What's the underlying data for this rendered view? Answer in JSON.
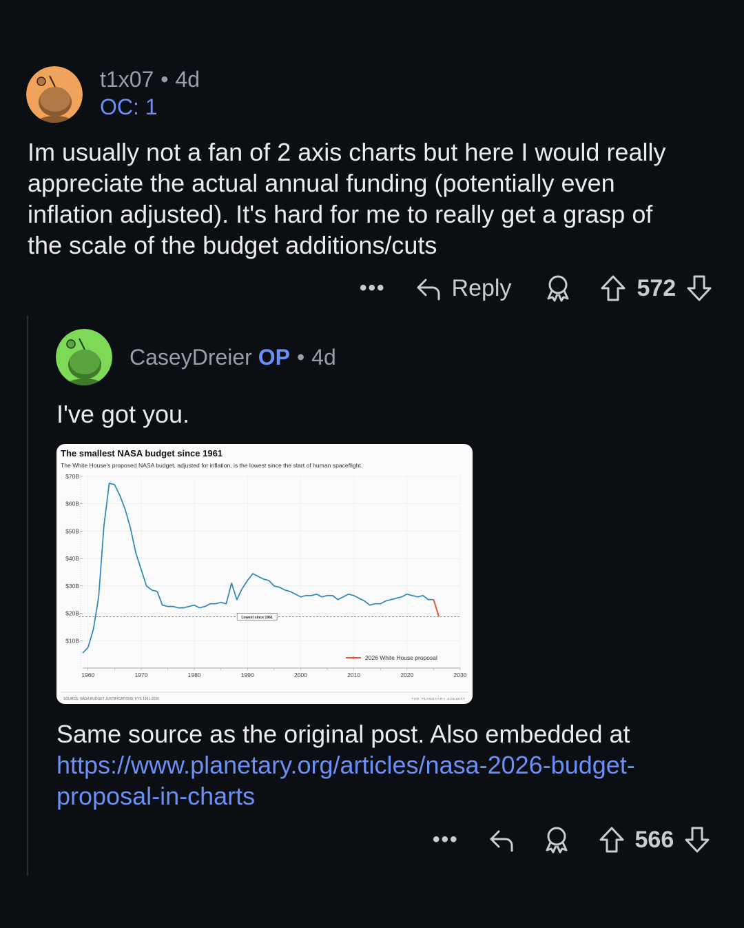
{
  "comments": [
    {
      "username": "t1x07",
      "separator": "•",
      "age": "4d",
      "flair": "OC: 1",
      "avatar_color": "#f0a35a",
      "body": [
        "Im usually not a fan of 2 axis charts but here I would really",
        "appreciate the actual annual funding (potentially even",
        "inflation adjusted). It's hard for me to really get a grasp of",
        "the scale of the budget additions/cuts"
      ],
      "actions": {
        "more": "•••",
        "reply_label": "Reply",
        "score": "572"
      }
    },
    {
      "username": "CaseyDreier",
      "op_badge": "OP",
      "separator": "•",
      "age": "4d",
      "avatar_color": "#7ed957",
      "body_intro": "I've got you.",
      "body_after": "Same source as the original post. Also embedded at",
      "link_lines": [
        "https://www.planetary.org/articles/nasa-2026-budget-",
        "proposal-in-charts"
      ],
      "actions": {
        "more": "•••",
        "score": "566"
      }
    }
  ],
  "chart_data": {
    "type": "line",
    "title": "The smallest NASA budget since 1961",
    "subtitle": "The White House's proposed NASA budget, adjusted for inflation, is the lowest since the start of human spaceflight.",
    "y_ticks": [
      "$70B",
      "$60B",
      "$50B",
      "$40B",
      "$30B",
      "$20B",
      "$10B"
    ],
    "y_tick_values": [
      70,
      60,
      50,
      40,
      30,
      20,
      10
    ],
    "x_ticks": [
      "1960",
      "1970",
      "1980",
      "1990",
      "2000",
      "2010",
      "2020",
      "2030"
    ],
    "x_tick_values": [
      1960,
      1970,
      1980,
      1990,
      2000,
      2010,
      2020,
      2030
    ],
    "xlim": [
      1959,
      2030
    ],
    "ylim": [
      0,
      70
    ],
    "series": [
      {
        "color": "#2a86b8",
        "x": [
          1959,
          1960,
          1961,
          1962,
          1963,
          1964,
          1965,
          1966,
          1967,
          1968,
          1969,
          1970,
          1971,
          1972,
          1973,
          1974,
          1975,
          1976,
          1977,
          1978,
          1979,
          1980,
          1981,
          1982,
          1983,
          1984,
          1985,
          1986,
          1987,
          1988,
          1989,
          1990,
          1991,
          1992,
          1993,
          1994,
          1995,
          1996,
          1997,
          1998,
          1999,
          2000,
          2001,
          2002,
          2003,
          2004,
          2005,
          2006,
          2007,
          2008,
          2009,
          2010,
          2011,
          2012,
          2013,
          2014,
          2015,
          2016,
          2017,
          2018,
          2019,
          2020,
          2021,
          2022,
          2023,
          2024,
          2025
        ],
        "y": [
          5.5,
          7.5,
          14,
          26,
          52,
          67.5,
          67,
          63,
          58,
          51,
          42,
          36,
          30,
          28.5,
          28,
          23,
          22.5,
          22.5,
          22,
          22,
          22.5,
          23,
          22,
          22.5,
          23.5,
          23.5,
          24,
          23.5,
          31,
          25,
          29,
          32,
          34.5,
          33.5,
          32.5,
          32,
          30,
          29.5,
          28.5,
          28,
          27,
          26,
          26.5,
          26.5,
          27,
          26,
          26.5,
          26.5,
          25,
          26,
          27,
          26.5,
          25.5,
          24.5,
          23,
          23.5,
          23.5,
          24.5,
          25,
          25.5,
          26,
          27,
          26.5,
          26,
          26.5,
          25,
          25
        ]
      },
      {
        "name": "2026 White House proposal",
        "color": "#e4543a",
        "x": [
          2025,
          2026
        ],
        "y": [
          25,
          18.8
        ]
      }
    ],
    "reference_line": {
      "y": 18.8,
      "label": "Lowest since 1961"
    },
    "legend_position": "bottom-right",
    "source": "SOURCE: NASA BUDGET JUSTIFICATIONS, FYS 1961-2026",
    "logo_text": "THE PLANETARY SOCIETY"
  }
}
